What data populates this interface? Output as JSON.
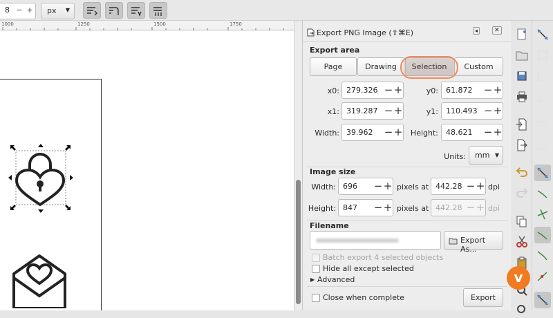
{
  "toolbar": {
    "value_field": "8",
    "minus": "−",
    "plus": "+",
    "unit": "px",
    "buttons": [
      "transform-stroke-icon",
      "transform-corners-icon",
      "transform-gradients-icon",
      "transform-patterns-icon"
    ]
  },
  "ruler": {
    "labels": [
      "1000",
      "1250",
      "1500",
      "1750"
    ]
  },
  "dialog": {
    "title": "Export PNG Image (⇧⌘E)",
    "export_area": {
      "heading": "Export area",
      "tabs": [
        "Page",
        "Drawing",
        "Selection",
        "Custom"
      ],
      "active_tab": "Selection",
      "x0_label": "x0:",
      "x0": "279.326",
      "y0_label": "y0:",
      "y0": "61.872",
      "x1_label": "x1:",
      "x1": "319.287",
      "y1_label": "y1:",
      "y1": "110.493",
      "width_label": "Width:",
      "width": "39.962",
      "height_label": "Height:",
      "height": "48.621",
      "units_label": "Units:",
      "units": "mm"
    },
    "image_size": {
      "heading": "Image size",
      "width_label": "Width:",
      "width": "696",
      "height_label": "Height:",
      "height": "847",
      "pixels_at": "pixels at",
      "dpi_value": "442.28",
      "dpi_value_disabled": "442.28",
      "dpi": "dpi"
    },
    "filename": {
      "heading": "Filename",
      "export_as": "Export As..."
    },
    "options": {
      "batch": "Batch export 4 selected objects",
      "hide": "Hide all except selected",
      "advanced": "Advanced",
      "close": "Close when complete",
      "export": "Export"
    }
  },
  "colors": {
    "highlight": "#f08a5d",
    "vimeo": "#f07b22"
  }
}
